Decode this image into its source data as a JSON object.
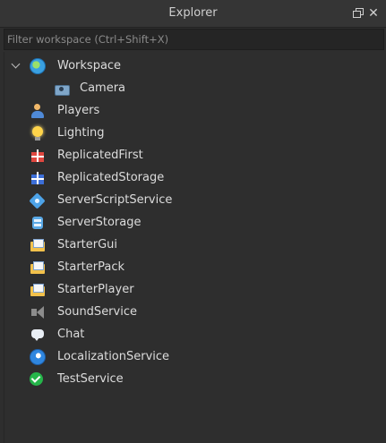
{
  "window": {
    "title": "Explorer",
    "float_icon": "float-window-icon",
    "close_icon": "close-icon",
    "close_glyph": "✕"
  },
  "filter": {
    "placeholder": "Filter workspace (Ctrl+Shift+X)",
    "value": ""
  },
  "tree": {
    "items": [
      {
        "label": "Workspace",
        "icon": "workspace-globe-icon",
        "expanded": true
      },
      {
        "label": "Camera",
        "icon": "camera-icon"
      },
      {
        "label": "Players",
        "icon": "players-icon"
      },
      {
        "label": "Lighting",
        "icon": "lightbulb-icon"
      },
      {
        "label": "ReplicatedFirst",
        "icon": "replicated-first-icon"
      },
      {
        "label": "ReplicatedStorage",
        "icon": "replicated-storage-icon"
      },
      {
        "label": "ServerScriptService",
        "icon": "server-script-service-icon"
      },
      {
        "label": "ServerStorage",
        "icon": "server-storage-icon"
      },
      {
        "label": "StarterGui",
        "icon": "starter-gui-icon"
      },
      {
        "label": "StarterPack",
        "icon": "starter-pack-icon"
      },
      {
        "label": "StarterPlayer",
        "icon": "starter-player-icon"
      },
      {
        "label": "SoundService",
        "icon": "sound-service-icon"
      },
      {
        "label": "Chat",
        "icon": "chat-icon"
      },
      {
        "label": "LocalizationService",
        "icon": "localization-service-icon"
      },
      {
        "label": "TestService",
        "icon": "test-service-checkmark-icon"
      }
    ]
  },
  "colors": {
    "background": "#2e2e2e",
    "titlebar": "#353535",
    "text": "#dcdcdc",
    "filter_bg": "#252525"
  }
}
